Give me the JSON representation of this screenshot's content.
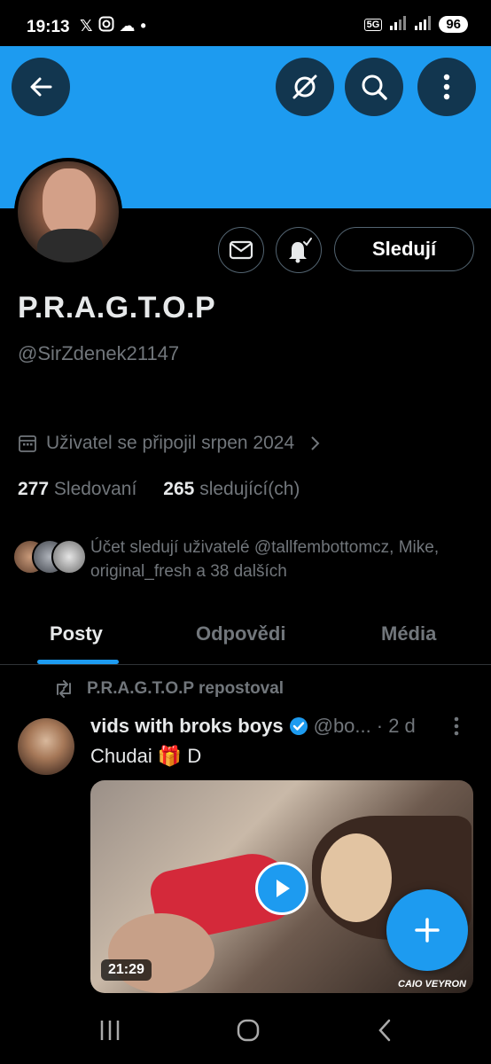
{
  "status_bar": {
    "time": "19:13",
    "notification_icons": [
      "x-logo-icon",
      "instagram-icon",
      "weather-icon",
      "dot-icon"
    ],
    "network": "5G",
    "battery": "96"
  },
  "profile": {
    "display_name": "P.R.A.G.T.O.P",
    "handle": "@SirZdenek21147",
    "joined": "Uživatel se připojil srpen 2024",
    "following_count": "277",
    "following_label": "Sledovaní",
    "followers_count": "265",
    "followers_label": "sledující(ch)",
    "followed_by": "Účet sledují uživatelé @tallfembottomcz, Mike, original_fresh a 38 dalších",
    "follow_button": "Sledují"
  },
  "tabs": [
    {
      "label": "Posty",
      "active": true
    },
    {
      "label": "Odpovědi",
      "active": false
    },
    {
      "label": "Média",
      "active": false
    }
  ],
  "post": {
    "repost_label": "P.R.A.G.T.O.P repostoval",
    "author_name": "vids with broks boys",
    "author_handle": "@bo...",
    "time": "· 2 d",
    "text": "Chudai 🎁 D",
    "video_duration": "21:29",
    "watermark": "CAIO VEYRON"
  },
  "colors": {
    "accent": "#1d9bf0",
    "background": "#000000",
    "text_primary": "#e7e9ea",
    "text_secondary": "#71767b"
  }
}
